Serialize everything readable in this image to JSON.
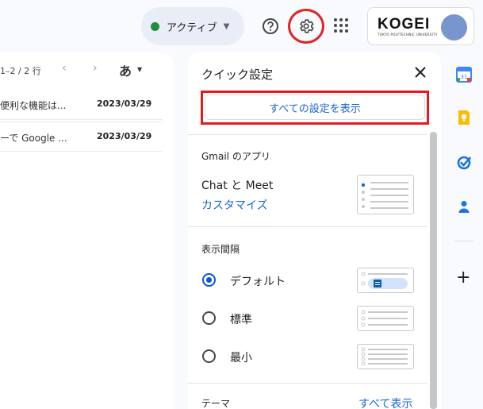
{
  "header": {
    "status": {
      "label": "アクティブ",
      "color": "#1e8e3e"
    },
    "icons": [
      "help-icon",
      "gear-icon",
      "apps-grid-icon"
    ],
    "account": {
      "logo_text": "KOGEI",
      "logo_subtext": "TOKYO POLYTECHNIC UNIVERSITY"
    }
  },
  "mail_list": {
    "pager": "1–2 / 2 行",
    "lang_button": "あ",
    "rows": [
      {
        "snippet": "便利な機能は...",
        "date": "2023/03/29"
      },
      {
        "snippet": "ーで Google ...",
        "date": "2023/03/29"
      }
    ]
  },
  "quick_settings": {
    "title": "クイック設定",
    "all_settings_button": "すべての設定を表示",
    "apps_section": {
      "title": "Gmail のアプリ",
      "label": "Chat と Meet",
      "link": "カスタマイズ"
    },
    "density_section": {
      "title": "表示間隔",
      "options": [
        {
          "label": "デフォルト",
          "selected": true
        },
        {
          "label": "標準",
          "selected": false
        },
        {
          "label": "最小",
          "selected": false
        }
      ]
    },
    "theme_section": {
      "title": "テーマ",
      "link": "すべて表示"
    }
  },
  "side_panel": {
    "icons": [
      "calendar-icon",
      "keep-icon",
      "tasks-icon",
      "contacts-icon",
      "add-icon"
    ],
    "calendar_day": "31"
  },
  "colors": {
    "accent": "#0b57d0",
    "link": "#1a66d2",
    "highlight": "#e01d1d"
  }
}
